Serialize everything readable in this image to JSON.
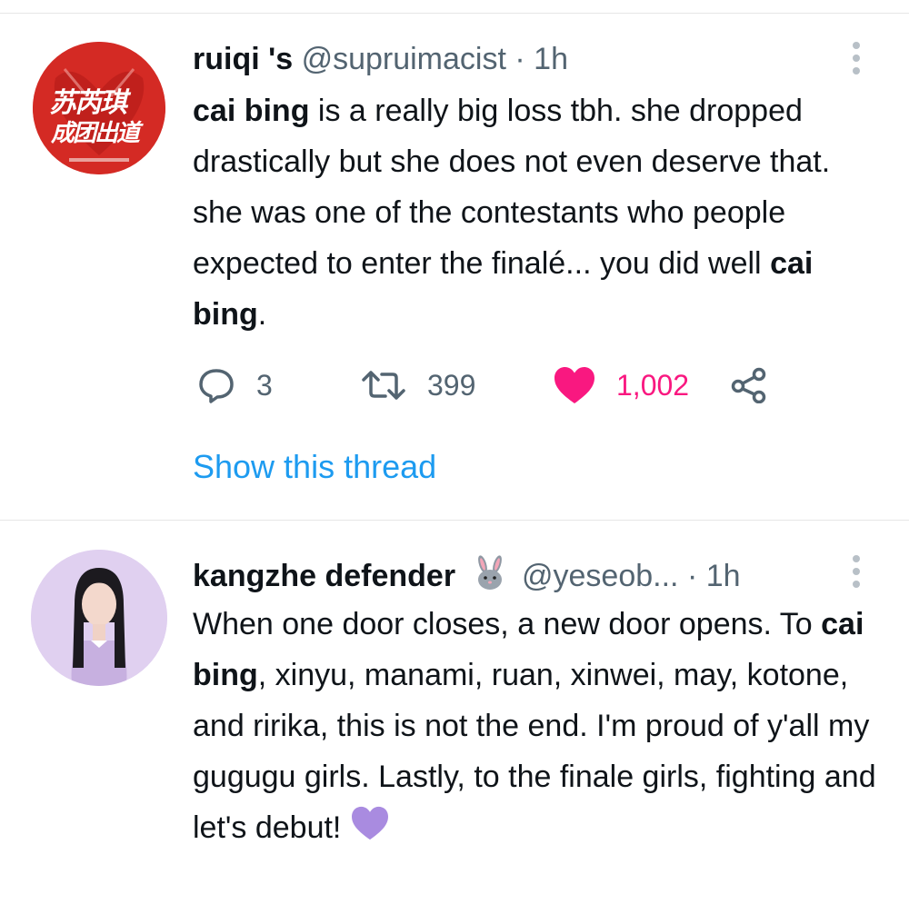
{
  "tweets": [
    {
      "display_name": "ruiqi 's",
      "handle": "@supruimacist",
      "separator": "·",
      "time": "1h",
      "avatar_text": {
        "line1": "苏芮琪",
        "line2": "成团出道"
      },
      "body": {
        "p1": "cai bing",
        "p2": " is a really big loss tbh. she dropped drastically but she does not even deserve that. she was one of the contestants who people expected to enter the finalé... you did well ",
        "p3": "cai bing",
        "p4": "."
      },
      "actions": {
        "replies": "3",
        "retweets": "399",
        "likes": "1,002"
      },
      "show_thread": "Show this thread"
    },
    {
      "display_name": "kangzhe defender",
      "handle": "@yeseob...",
      "separator": "·",
      "time": "1h",
      "name_emoji": "rabbit-emoji",
      "body": {
        "p1": "When one door closes, a new door opens. To ",
        "p2": "cai bing",
        "p3": ", xinyu, manami, ruan, xinwei, may, kotone, and ririka, this is not the end. I'm proud of y'all my gugugu girls. Lastly, to the finale girls, fighting and let's debut!"
      },
      "end_emoji": "purple-heart-emoji"
    }
  ],
  "colors": {
    "like_pink": "#f91880",
    "link_blue": "#1d9bf0",
    "muted_gray": "#536471",
    "purple_heart": "#a98be0",
    "avatar_red": "#d42a24"
  }
}
